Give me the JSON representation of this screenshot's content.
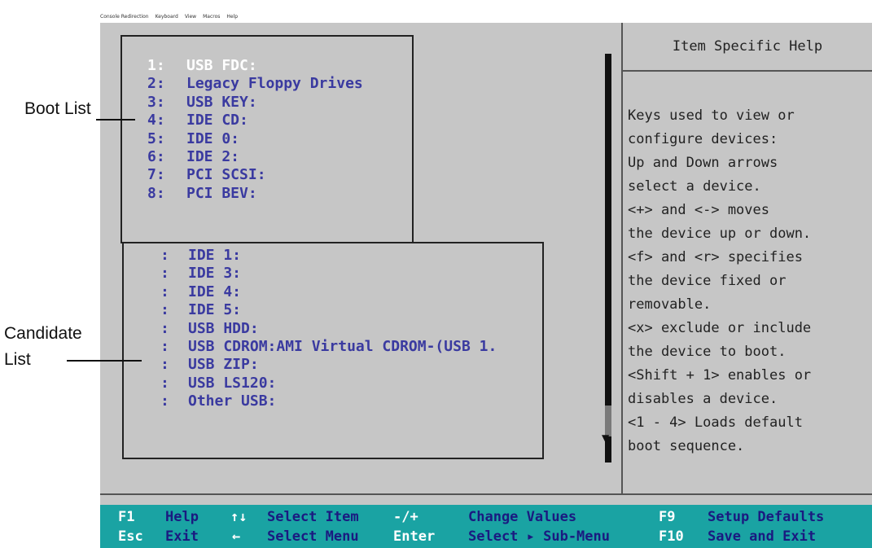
{
  "menubar": {
    "items": [
      "Console Redirection",
      "Keyboard",
      "View",
      "Macros",
      "Help"
    ]
  },
  "boot_list": [
    {
      "num": "1:",
      "name": "USB FDC:",
      "selected": true
    },
    {
      "num": "2:",
      "name": "Legacy Floppy Drives"
    },
    {
      "num": "3:",
      "name": "USB KEY:"
    },
    {
      "num": "4:",
      "name": "IDE CD:"
    },
    {
      "num": "5:",
      "name": "IDE 0:"
    },
    {
      "num": "6:",
      "name": "IDE 2:"
    },
    {
      "num": "7:",
      "name": "PCI SCSI:"
    },
    {
      "num": "8:",
      "name": "PCI BEV:"
    }
  ],
  "candidate_list": [
    {
      "num": ":",
      "name": "IDE 1:"
    },
    {
      "num": ":",
      "name": "IDE 3:"
    },
    {
      "num": ":",
      "name": "IDE 4:"
    },
    {
      "num": ":",
      "name": "IDE 5:"
    },
    {
      "num": ":",
      "name": "USB HDD:"
    },
    {
      "num": ":",
      "name": "USB CDROM:AMI Virtual CDROM-(USB 1."
    },
    {
      "num": ":",
      "name": "USB ZIP:"
    },
    {
      "num": ":",
      "name": "USB LS120:"
    },
    {
      "num": ":",
      "name": "Other USB:"
    }
  ],
  "help": {
    "title": "Item Specific Help",
    "lines": [
      "Keys used to view or",
      "configure devices:",
      "Up and Down arrows",
      "select a device.",
      "<+> and <-> moves",
      "the device up or down.",
      "<f> and <r> specifies",
      "the device fixed or",
      "removable.",
      "<x> exclude or include",
      "the device to boot.",
      "<Shift + 1> enables or",
      "disables a device.",
      "<1 - 4> Loads default",
      "boot sequence."
    ]
  },
  "keybar": {
    "row1": [
      {
        "key": "F1",
        "desc": "Help"
      },
      {
        "key": "↑↓",
        "desc": "Select Item"
      },
      {
        "key": "-/+",
        "desc": "Change Values"
      },
      {
        "key": "F9",
        "desc": "Setup Defaults"
      }
    ],
    "row2": [
      {
        "key": "Esc",
        "desc": "Exit"
      },
      {
        "key": "←",
        "desc": "Select Menu"
      },
      {
        "key": "Enter",
        "desc": "Select ▸ Sub-Menu"
      },
      {
        "key": "F10",
        "desc": "Save and Exit"
      }
    ]
  },
  "annotations": {
    "boot_list_label": "Boot List",
    "candidate_list_label_1": "Candidate",
    "candidate_list_label_2": "List"
  },
  "scrollbar": {
    "arrow": "▼"
  },
  "colors": {
    "screen_bg": "#c6c6c6",
    "item_text": "#3a3aa0",
    "selected_text": "#ffffff",
    "keybar_bg": "#1aa3a3"
  }
}
